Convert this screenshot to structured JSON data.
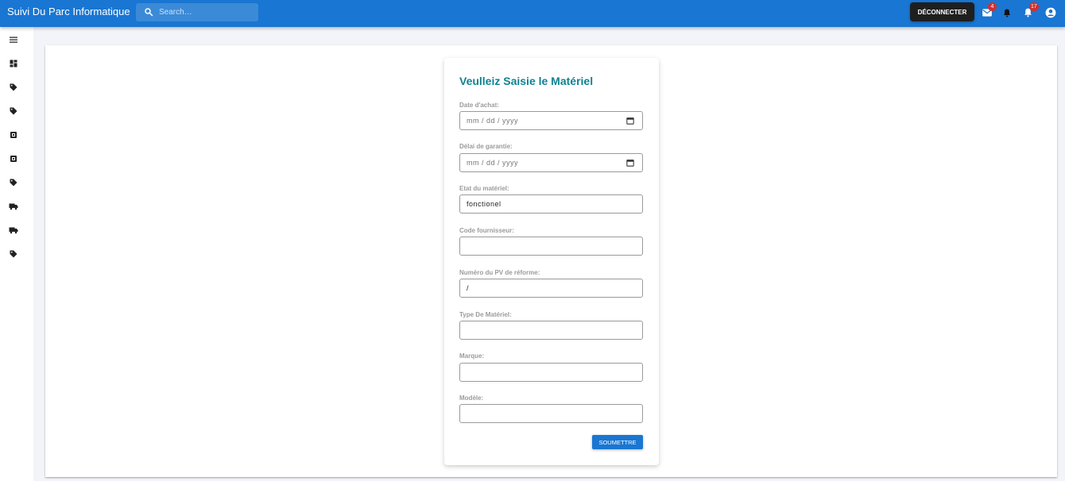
{
  "app": {
    "title": "Suivi Du Parc Informatique"
  },
  "search": {
    "placeholder": "Search…"
  },
  "header": {
    "logout_label": "DÉCONNECTER",
    "mail_badge": "4",
    "notifications_badge": "17"
  },
  "sidebar": {
    "icons": [
      "menu-icon",
      "dashboard-icon",
      "tag-icon",
      "tag-icon",
      "chip-icon",
      "chip-icon",
      "tag-icon",
      "truck-icon",
      "truck-icon",
      "tag-icon"
    ]
  },
  "form": {
    "title": "Veulleiz Saisie le Matériel",
    "fields": [
      {
        "label": "Date d'achat:",
        "placeholder": "mm / dd / yyyy",
        "value": ""
      },
      {
        "label": "Délai de garantie:",
        "placeholder": "mm / dd / yyyy",
        "value": ""
      },
      {
        "label": "Etat du matériel:",
        "placeholder": "",
        "value": "fonctionel"
      },
      {
        "label": "Code fournisseur:",
        "placeholder": "",
        "value": ""
      },
      {
        "label": "Numéro du PV de réforme:",
        "placeholder": "",
        "value": "/"
      },
      {
        "label": "Type De Matériel:",
        "placeholder": "",
        "value": ""
      },
      {
        "label": "Marque:",
        "placeholder": "",
        "value": ""
      },
      {
        "label": "Modèle:",
        "placeholder": "",
        "value": ""
      }
    ],
    "submit_label": "SOUMETTRE"
  },
  "colors": {
    "appbar": "#1976d2",
    "title": "#0d8390",
    "logout": "#1f1f1f",
    "badge": "#d32f2f"
  }
}
